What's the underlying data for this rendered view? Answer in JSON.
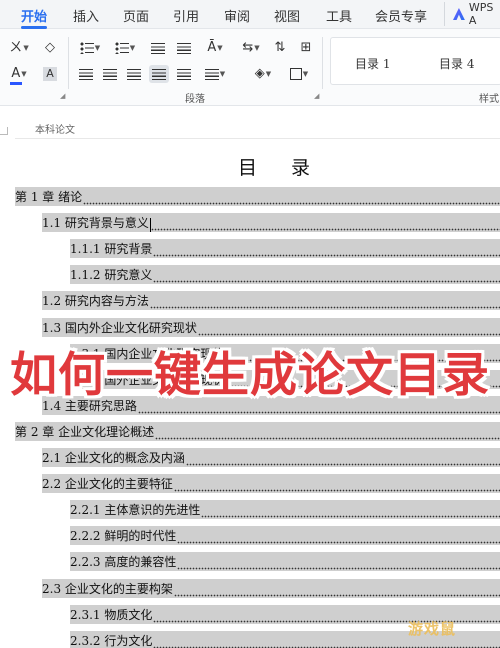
{
  "menu": {
    "tabs": [
      "开始",
      "插入",
      "页面",
      "引用",
      "审阅",
      "视图",
      "工具",
      "会员专享"
    ],
    "active_tab": "开始",
    "ai_button": "WPS A"
  },
  "ribbon": {
    "phonetic_glyph": "ㄨ",
    "clear_glyph": "◇",
    "font_color_glyph": "A",
    "char_shade_glyph": "A",
    "paragraph_group_label": "段落",
    "style_gallery": [
      "目录 1",
      "目录 4"
    ],
    "styles_group_label": "样式"
  },
  "document": {
    "header_text": "本科论文",
    "title": "目 录",
    "toc": [
      {
        "level": 0,
        "text": "第 1 章  绪论"
      },
      {
        "level": 1,
        "text": "1.1 研究背景与意义"
      },
      {
        "level": 2,
        "text": "1.1.1 研究背景"
      },
      {
        "level": 2,
        "text": "1.1.2 研究意义"
      },
      {
        "level": 1,
        "text": "1.2 研究内容与方法"
      },
      {
        "level": 1,
        "text": "1.3 国内外企业文化研究现状"
      },
      {
        "level": 2,
        "text": "1.3.1 国内企业文化研究现状"
      },
      {
        "level": 2,
        "text": "1.3.2 国外企业文化研究现状"
      },
      {
        "level": 1,
        "text": "1.4 主要研究思路"
      },
      {
        "level": 0,
        "text": "第 2 章  企业文化理论概述"
      },
      {
        "level": 1,
        "text": "2.1 企业文化的概念及内涵"
      },
      {
        "level": 1,
        "text": "2.2 企业文化的主要特征"
      },
      {
        "level": 2,
        "text": "2.2.1 主体意识的先进性"
      },
      {
        "level": 2,
        "text": "2.2.2 鲜明的时代性"
      },
      {
        "level": 2,
        "text": "2.2.3 高度的兼容性"
      },
      {
        "level": 1,
        "text": "2.3 企业文化的主要构架"
      },
      {
        "level": 2,
        "text": "2.3.1 物质文化"
      },
      {
        "level": 2,
        "text": "2.3.2 行为文化"
      }
    ]
  },
  "overlay": {
    "headline": "如何一键生成论文目录",
    "watermark": "游戏鼠"
  },
  "colors": {
    "accent": "#2a6ff0",
    "headline": "#e0393c",
    "toc_highlight": "#cfcfcf"
  }
}
